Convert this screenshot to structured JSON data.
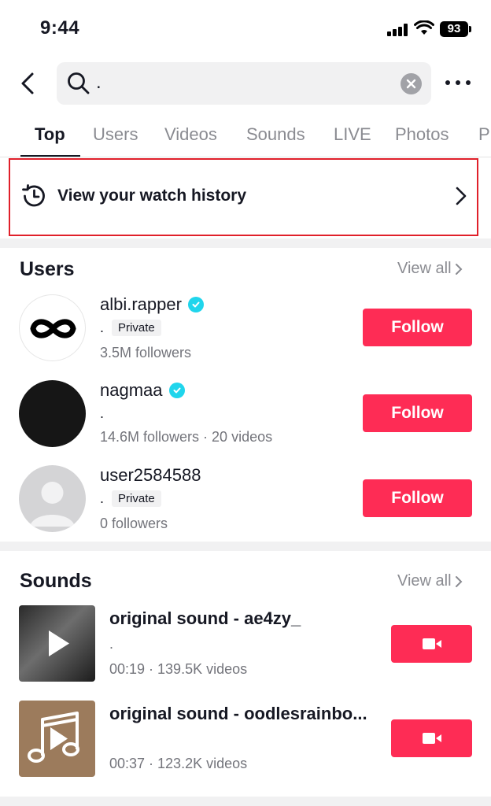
{
  "status_bar": {
    "time": "9:44",
    "battery": "93"
  },
  "search": {
    "query": "."
  },
  "tabs": [
    {
      "label": "Top",
      "active": true
    },
    {
      "label": "Users"
    },
    {
      "label": "Videos"
    },
    {
      "label": "Sounds"
    },
    {
      "label": "LIVE"
    },
    {
      "label": "Photos"
    },
    {
      "label": "P"
    }
  ],
  "watch_history": {
    "label": "View your watch history"
  },
  "users_section": {
    "title": "Users",
    "view_all": "View all",
    "items": [
      {
        "name": "albi.rapper",
        "verified": true,
        "bio": ".",
        "badge": "Private",
        "meta": "3.5M followers",
        "follow": "Follow"
      },
      {
        "name": "nagmaa",
        "verified": true,
        "bio": ".",
        "badge": "",
        "meta": "14.6M followers · 20 videos",
        "follow": "Follow"
      },
      {
        "name": "user2584588",
        "verified": false,
        "bio": ".",
        "badge": "Private",
        "meta": "0 followers",
        "follow": "Follow"
      }
    ]
  },
  "sounds_section": {
    "title": "Sounds",
    "view_all": "View all",
    "items": [
      {
        "title": "original sound - ae4zy_",
        "sub": ".",
        "meta": "00:19 · 139.5K videos"
      },
      {
        "title": "original sound - oodlesrainbo...",
        "sub": "",
        "meta": "00:37 · 123.2K videos"
      }
    ]
  },
  "colors": {
    "accent": "#fe2c55",
    "verified": "#20d5ec",
    "highlight_border": "#e0202a",
    "muted": "#8a8b91"
  }
}
